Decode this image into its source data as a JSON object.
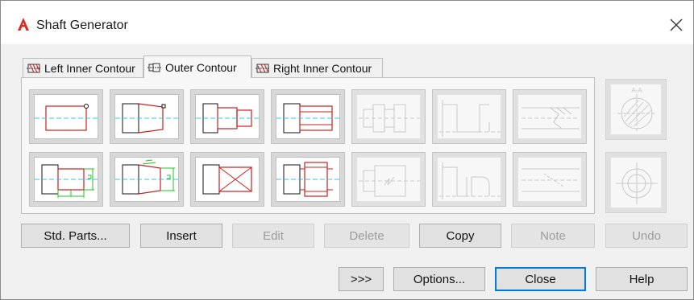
{
  "window": {
    "title": "Shaft Generator"
  },
  "tabs": [
    {
      "label": "Left Inner Contour",
      "active": false
    },
    {
      "label": "Outer Contour",
      "active": true
    },
    {
      "label": "Right Inner Contour",
      "active": false
    }
  ],
  "toolbar_row1": [
    {
      "icon": "cylinder-icon",
      "enabled": true
    },
    {
      "icon": "cone-icon",
      "enabled": true
    },
    {
      "icon": "shoulder-icon",
      "enabled": true
    },
    {
      "icon": "step-shaft-icon",
      "enabled": true
    },
    {
      "icon": "bearing-section-icon",
      "enabled": false
    },
    {
      "icon": "groove-section-icon",
      "enabled": false
    },
    {
      "icon": "thread-section-icon",
      "enabled": false
    }
  ],
  "toolbar_row2": [
    {
      "icon": "cylinder-dimension-icon",
      "enabled": true
    },
    {
      "icon": "cone-dimension-icon",
      "enabled": true
    },
    {
      "icon": "polygon-cross-icon",
      "enabled": true
    },
    {
      "icon": "profile-section-icon",
      "enabled": true
    },
    {
      "icon": "break-section-icon",
      "enabled": false
    },
    {
      "icon": "undercut-section-icon",
      "enabled": false
    },
    {
      "icon": "chamfer-section-icon",
      "enabled": false
    }
  ],
  "side_tools": [
    {
      "icon": "cross-section-icon",
      "label": "A-A",
      "enabled": false
    },
    {
      "icon": "side-view-icon",
      "enabled": false
    }
  ],
  "action_buttons": [
    {
      "label": "Std. Parts...",
      "enabled": true
    },
    {
      "label": "Insert",
      "enabled": true
    },
    {
      "label": "Edit",
      "enabled": false
    },
    {
      "label": "Delete",
      "enabled": false
    },
    {
      "label": "Copy",
      "enabled": true
    },
    {
      "label": "Note",
      "enabled": false
    },
    {
      "label": "Undo",
      "enabled": false
    }
  ],
  "footer_buttons": [
    {
      "label": ">>>"
    },
    {
      "label": "Options..."
    },
    {
      "label": "Close",
      "default": true
    },
    {
      "label": "Help"
    }
  ],
  "colors": {
    "accent": "#0078d7",
    "contour_red": "#cc1f1f",
    "centerline_cyan": "#27c8e8",
    "dimension_green": "#1fc41f",
    "app_red": "#d62d20"
  }
}
